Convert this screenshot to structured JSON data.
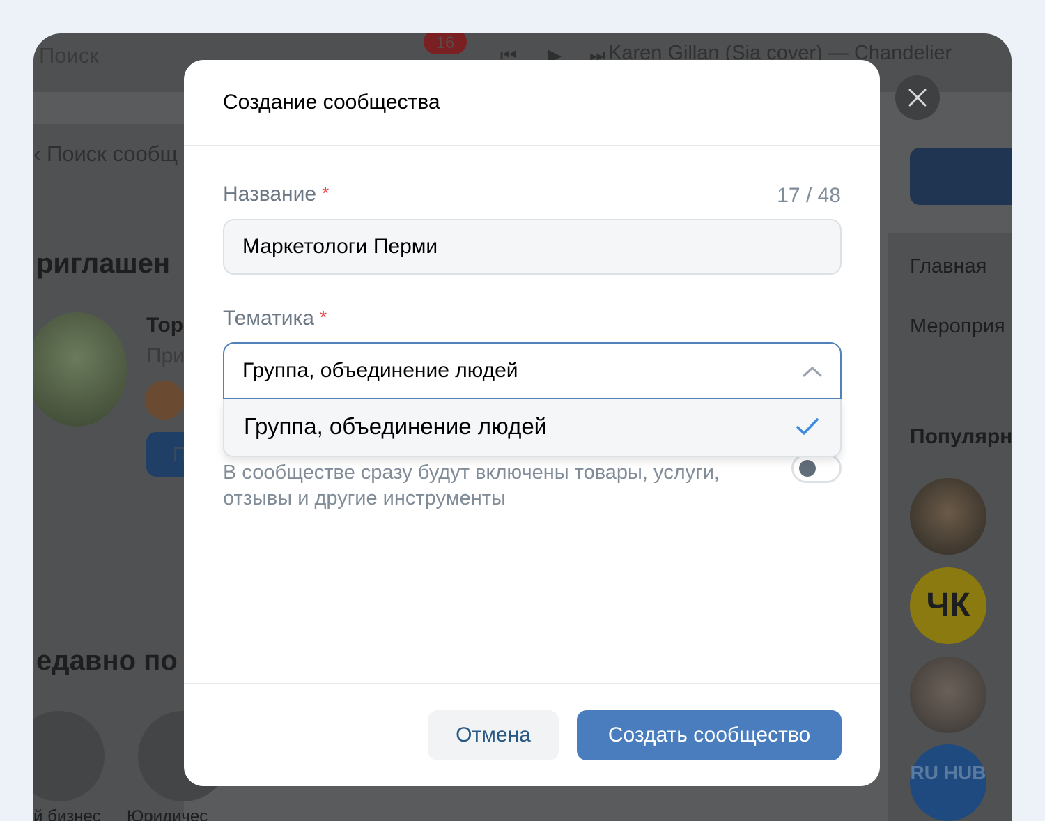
{
  "background": {
    "search_placeholder": "Поиск",
    "notification_count": "16",
    "player": {
      "track": "Karen Gillan (Sia cover) — Chandelier"
    },
    "left": {
      "search_placeholder": "Поиск сообщ",
      "invitations_heading": "риглашен",
      "invite_name": "Тор",
      "invite_sub": "При",
      "invite_button": "П",
      "recent_heading": "едавно по",
      "recent_items": [
        "й бизнес",
        "Юридичес"
      ]
    },
    "right": {
      "nav": [
        "Главная",
        "Мероприя"
      ],
      "popular_heading": "Популярн",
      "popular_logo_1": "ЧК",
      "popular_logo_2": "RU HUB"
    }
  },
  "modal": {
    "title": "Создание сообщества",
    "name_field": {
      "label": "Название",
      "required_mark": "*",
      "counter": "17 / 48",
      "value": "Маркетологи Перми"
    },
    "topic_field": {
      "label": "Тематика",
      "required_mark": "*",
      "selected": "Группа, объединение людей",
      "options": [
        {
          "label": "Группа, объединение людей",
          "selected": true
        }
      ]
    },
    "business_toggle": {
      "description": "В сообществе сразу будут включены товары, услуги, отзывы и другие инструменты",
      "enabled": false
    },
    "buttons": {
      "cancel": "Отмена",
      "create": "Создать сообщество"
    }
  },
  "colors": {
    "accent": "#4a7dbd",
    "link": "#2a5885",
    "required": "#e64646",
    "overlay": "#5a5b5c"
  }
}
